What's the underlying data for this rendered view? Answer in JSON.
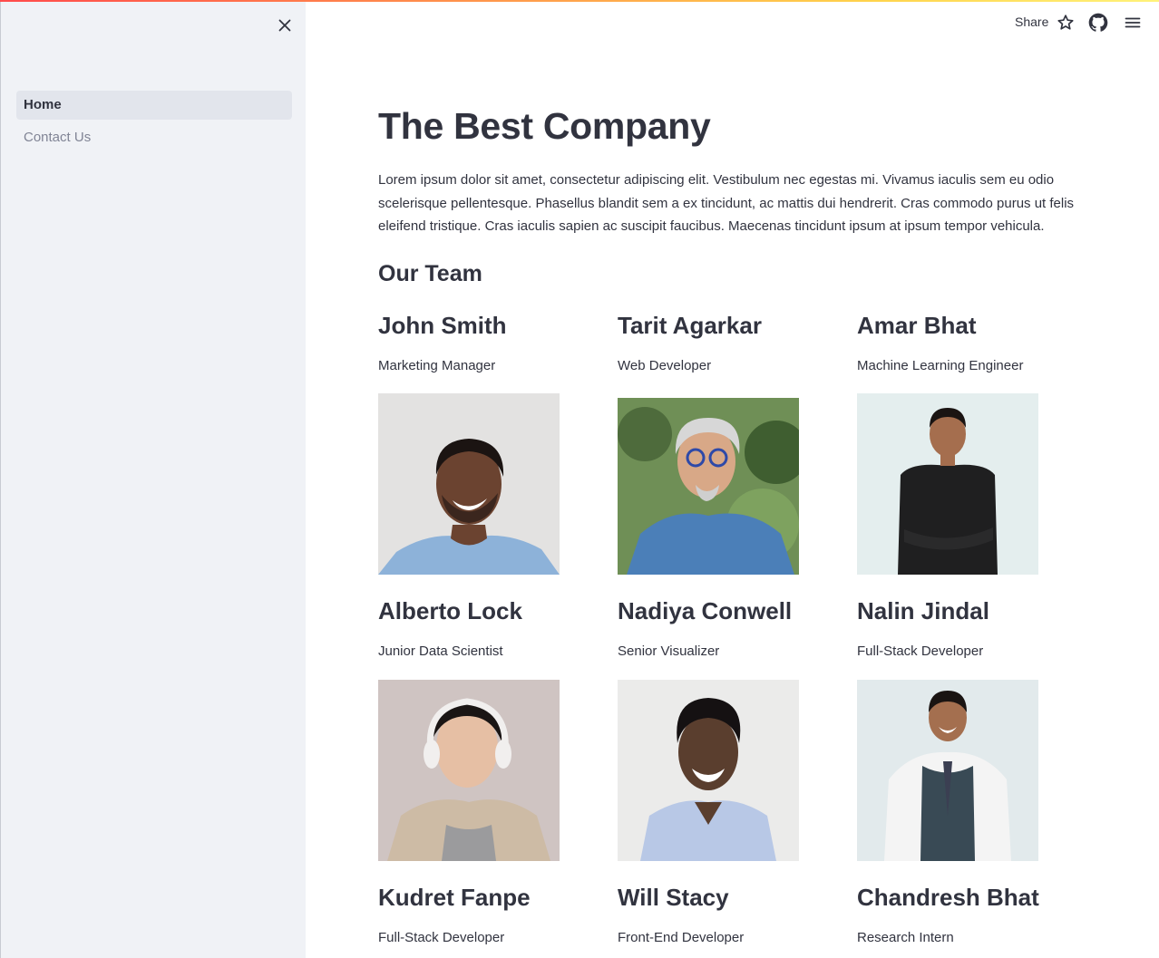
{
  "app": {
    "share_label": "Share",
    "accent_gradient": [
      "#ff4b4b",
      "#ffd34b",
      "#fff27a"
    ]
  },
  "sidebar": {
    "items": [
      {
        "label": "Home",
        "active": true
      },
      {
        "label": "Contact Us",
        "active": false
      }
    ]
  },
  "header": {
    "icons": [
      "close-icon",
      "star-icon",
      "github-icon",
      "hamburger-menu-icon"
    ]
  },
  "main": {
    "title": "The Best Company",
    "intro": "Lorem ipsum dolor sit amet, consectetur adipiscing elit. Vestibulum nec egestas mi. Vivamus iaculis sem eu odio scelerisque pellentesque. Phasellus blandit sem a ex tincidunt, ac mattis dui hendrerit. Cras commodo purus ut felis eleifend tristique. Cras iaculis sapien ac suscipit faucibus. Maecenas tincidunt ipsum at ipsum tempor vehicula.",
    "team_heading": "Our Team",
    "members": [
      {
        "name": "John Smith",
        "role": "Marketing Manager"
      },
      {
        "name": "Tarit Agarkar",
        "role": "Web Developer"
      },
      {
        "name": "Amar Bhat",
        "role": "Machine Learning Engineer"
      },
      {
        "name": "Alberto Lock",
        "role": "Junior Data Scientist"
      },
      {
        "name": "Nadiya Conwell",
        "role": "Senior Visualizer"
      },
      {
        "name": "Nalin Jindal",
        "role": "Full-Stack Developer"
      },
      {
        "name": "Kudret Fanpe",
        "role": "Full-Stack Developer"
      },
      {
        "name": "Will Stacy",
        "role": "Front-End Developer"
      },
      {
        "name": "Chandresh Bhat",
        "role": "Research Intern"
      }
    ]
  }
}
